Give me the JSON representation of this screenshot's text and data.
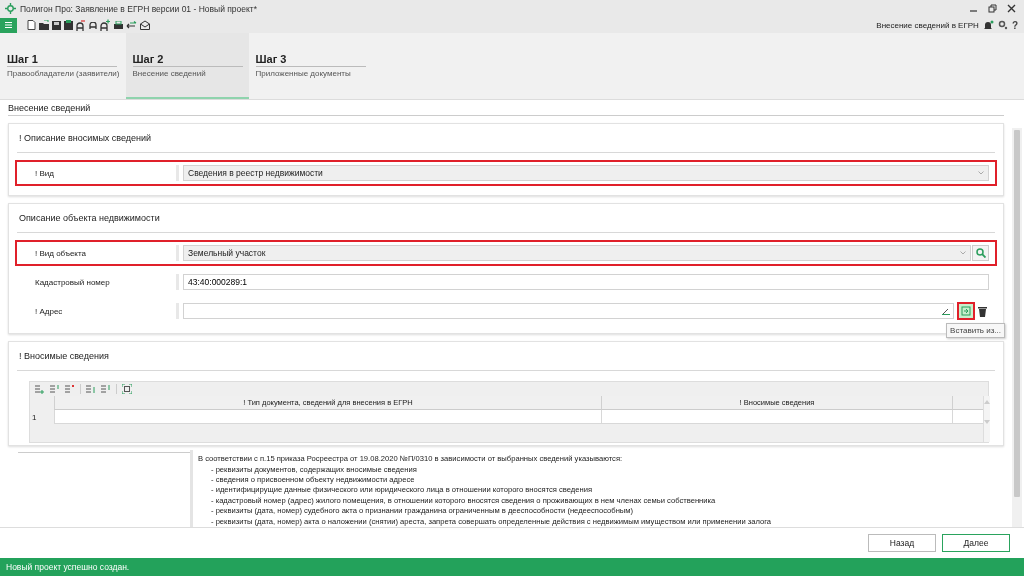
{
  "window": {
    "title": "Полигон Про: Заявление в ЕГРН версии 01 - Новый проект*"
  },
  "header": {
    "context": "Внесение сведений в ЕГРН",
    "help": "?"
  },
  "steps": [
    {
      "title": "Шаг 1",
      "subtitle": "Правообладатели (заявители)",
      "selected": false
    },
    {
      "title": "Шаг 2",
      "subtitle": "Внесение сведений",
      "selected": true
    },
    {
      "title": "Шаг 3",
      "subtitle": "Приложенные документы",
      "selected": false
    }
  ],
  "section_title": "Внесение сведений",
  "panels": [
    {
      "title": "! Описание вносимых сведений",
      "fields": [
        {
          "kind": "select",
          "label": "! Вид",
          "value": "Сведения в реестр недвижимости",
          "highlighted": true
        }
      ]
    },
    {
      "title": "Описание объекта недвижимости",
      "fields": [
        {
          "kind": "select-search",
          "label": "! Вид объекта",
          "value": "Земельный участок",
          "highlighted": true
        },
        {
          "kind": "text",
          "label": "Кадастровый номер",
          "value": "43:40:000289:1",
          "highlighted": false
        },
        {
          "kind": "address",
          "label": "! Адрес",
          "highlighted": false,
          "insert_highlighted": true,
          "tooltip": "Вставить из..."
        }
      ]
    }
  ],
  "records": {
    "title": "! Вносимые сведения",
    "columns": [
      "! Тип документа, сведений для внесения в ЕГРН",
      "! Вносимые сведения"
    ],
    "rows": [
      {
        "number": "1"
      }
    ]
  },
  "hint": {
    "intro": "В соответствии с п.15 приказа Росреестра от 19.08.2020 №П/0310 в зависимости от выбранных сведений указываются:",
    "items": [
      "- реквизиты документов, содержащих вносимые сведения",
      "- сведения о присвоенном объекту недвижимости адресе",
      "- идентифицирущие данные физического или юридического лица в отношении которого вносятся сведения",
      "- кадастровый номер (адрес) жилого помещения, в отношении которого вносятся сведения о проживающих в нем членах семьи собственника",
      "- реквизиты (дата, номер) судебного акта о признании гражданина ограниченным в дееспособности (недееспособным)",
      "- реквизиты (дата, номер) акта о наложении (снятии) ареста, запрета совершать определенные действия с недвижимым имуществом или применении залога"
    ]
  },
  "buttons": [
    {
      "label": "Назад",
      "kind": "secondary"
    },
    {
      "label": "Далее",
      "kind": "primary"
    }
  ],
  "status_bar": "Новый проект успешно создан."
}
